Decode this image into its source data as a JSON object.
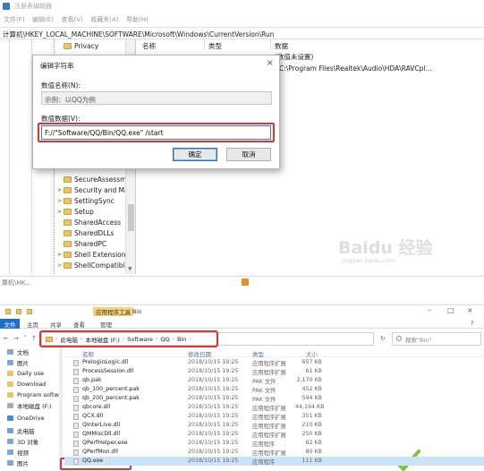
{
  "registry": {
    "title": "注册表编辑器",
    "menu": [
      "文件(F)",
      "编辑(E)",
      "查看(V)",
      "收藏夹(A)",
      "帮助(H)"
    ],
    "address": "计算机\\HKEY_LOCAL_MACHINE\\SOFTWARE\\Microsoft\\Windows\\CurrentVersion\\Run",
    "tree_items": [
      {
        "label": "Privacy",
        "expand": ""
      },
      {
        "label": "SecureAssessme",
        "expand": ""
      },
      {
        "label": "Security and Ma",
        "expand": ">"
      },
      {
        "label": "SettingSync",
        "expand": ">"
      },
      {
        "label": "Setup",
        "expand": ">"
      },
      {
        "label": "SharedAccess",
        "expand": ""
      },
      {
        "label": "SharedDLLs",
        "expand": ""
      },
      {
        "label": "SharedPC",
        "expand": ""
      },
      {
        "label": "Shell Extensions",
        "expand": ">"
      },
      {
        "label": "ShellCompatibili",
        "expand": ">"
      }
    ],
    "columns": {
      "name": "名称",
      "type": "类型",
      "data": "数据"
    },
    "value_data_1": "(数值未设置)",
    "value_data_2": "C:\\Program Files\\Realtek\\Audio\\HDA\\RAVCpl...",
    "status": "算机\\HK..."
  },
  "dialog": {
    "title": "编辑字符串",
    "close_glyph": "×",
    "name_label": "数值名称(N):",
    "name_value": "示例：以QQ为例",
    "data_label": "数值数据(V):",
    "data_value": "F://\"Software/QQ/Bin/QQ.exe\" /start",
    "ok_label": "确定",
    "cancel_label": "取消"
  },
  "watermark": {
    "text": "Baidu 经验",
    "sub": "jingyan.baidu.com"
  },
  "explorer": {
    "context_tab": "应用程序工具",
    "window_title": "Bin",
    "ribbon_file": "文件",
    "ribbon_tabs": [
      "主页",
      "共享",
      "查看",
      "管理"
    ],
    "path_segments": [
      "此电脑",
      "本地磁盘 (F:)",
      "Software",
      "QQ",
      "Bin"
    ],
    "search_placeholder": "搜索\"Bin\"",
    "sidebar": [
      {
        "label": "文档",
        "color": "#7fa7d6"
      },
      {
        "label": "图片",
        "color": "#7fa7d6"
      },
      {
        "label": "Daily use",
        "color": "#e9c46a"
      },
      {
        "label": "Download",
        "color": "#e9c46a"
      },
      {
        "label": "Program softw",
        "color": "#e9c46a"
      },
      {
        "label": "本地磁盘 (F:)",
        "color": "#aaaaaa"
      },
      {
        "label": "OneDrive",
        "color": "#3d8ee0"
      },
      {
        "label": "此电脑",
        "color": "#6fa0d8"
      },
      {
        "label": "3D 对象",
        "color": "#7fa7d6"
      },
      {
        "label": "视频",
        "color": "#7fa7d6"
      },
      {
        "label": "图片",
        "color": "#7fa7d6"
      }
    ],
    "columns": {
      "name": "名称",
      "date": "修改日期",
      "type": "类型",
      "size": "大小"
    },
    "files": [
      {
        "name": "PreloginLogic.dll",
        "date": "2018/10/15 19:25",
        "type": "应用程序扩展",
        "size": "657 KB"
      },
      {
        "name": "ProcessSession.dll",
        "date": "2018/10/15 19:25",
        "type": "应用程序扩展",
        "size": "61 KB"
      },
      {
        "name": "qb.pak",
        "date": "2018/10/15 19:25",
        "type": "PAK 文件",
        "size": "2,170 KB"
      },
      {
        "name": "qb_100_percent.pak",
        "date": "2018/10/15 19:25",
        "type": "PAK 文件",
        "size": "452 KB"
      },
      {
        "name": "qb_200_percent.pak",
        "date": "2018/10/15 19:25",
        "type": "PAK 文件",
        "size": "594 KB"
      },
      {
        "name": "qbcore.dll",
        "date": "2018/10/15 19:25",
        "type": "应用程序扩展",
        "size": "44,194 KB"
      },
      {
        "name": "QCX.dll",
        "date": "2018/10/15 19:25",
        "type": "应用程序扩展",
        "size": "351 KB"
      },
      {
        "name": "QInterLive.dll",
        "date": "2018/10/15 19:25",
        "type": "应用程序扩展",
        "size": "210 KB"
      },
      {
        "name": "QMMiscDll.dll",
        "date": "2018/10/15 19:25",
        "type": "应用程序扩展",
        "size": "250 KB"
      },
      {
        "name": "QPerfHelper.exe",
        "date": "2018/10/15 19:25",
        "type": "应用程序",
        "size": "62 KB"
      },
      {
        "name": "QPerfMon.dll",
        "date": "2018/10/15 19:25",
        "type": "应用程序扩展",
        "size": "80 KB"
      },
      {
        "name": "QQ.exe",
        "date": "2018/10/15 19:25",
        "type": "应用程序",
        "size": "111 KB"
      }
    ]
  },
  "colors": {
    "highlight_red": "#e0332f",
    "accent_blue": "#1e6fd0"
  }
}
